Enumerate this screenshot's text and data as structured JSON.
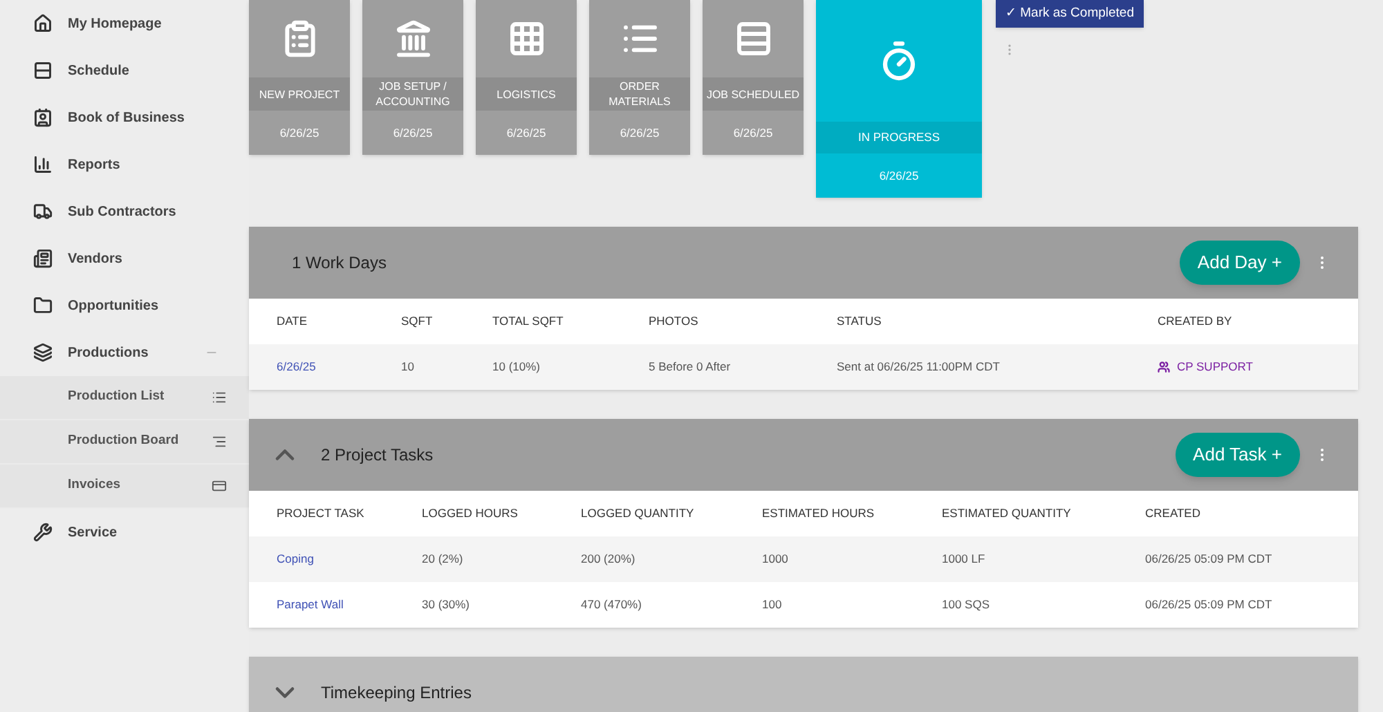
{
  "sidebar": {
    "items": [
      {
        "label": "My Homepage"
      },
      {
        "label": "Schedule"
      },
      {
        "label": "Book of Business"
      },
      {
        "label": "Reports"
      },
      {
        "label": "Sub Contractors"
      },
      {
        "label": "Vendors"
      },
      {
        "label": "Opportunities"
      },
      {
        "label": "Productions",
        "expanded": true,
        "children": [
          {
            "label": "Production List"
          },
          {
            "label": "Production Board"
          },
          {
            "label": "Invoices"
          }
        ]
      },
      {
        "label": "Service"
      }
    ]
  },
  "stages": [
    {
      "label": "NEW PROJECT",
      "date": "6/26/25",
      "current": false
    },
    {
      "label": "JOB SETUP / ACCOUNTING",
      "date": "6/26/25",
      "current": false
    },
    {
      "label": "LOGISTICS",
      "date": "6/26/25",
      "current": false
    },
    {
      "label": "ORDER MATERIALS",
      "date": "6/26/25",
      "current": false
    },
    {
      "label": "JOB SCHEDULED",
      "date": "6/26/25",
      "current": false
    },
    {
      "label": "IN PROGRESS",
      "date": "6/26/25",
      "current": true
    }
  ],
  "mark_button": "✓ Mark as Completed",
  "sections": [
    {
      "title": "1 Work Days",
      "button": "Add Day +",
      "columns": [
        {
          "label": "DATE",
          "kind": "link"
        },
        {
          "label": "SQFT",
          "kind": "text"
        },
        {
          "label": "TOTAL SQFT",
          "kind": "text"
        },
        {
          "label": "PHOTOS",
          "kind": "text"
        },
        {
          "label": "STATUS",
          "kind": "text"
        },
        {
          "label": "CREATED BY",
          "kind": "user"
        }
      ],
      "rows": [
        [
          "6/26/25",
          "10",
          "10 (10%)",
          "5 Before 0 After",
          "Sent at 06/26/25 11:00PM CDT",
          "CP SUPPORT"
        ]
      ]
    },
    {
      "title": "2 Project Tasks",
      "expanded": true,
      "button": "Add Task +",
      "columns": [
        {
          "label": "PROJECT TASK",
          "kind": "link"
        },
        {
          "label": "LOGGED HOURS",
          "kind": "text"
        },
        {
          "label": "LOGGED QUANTITY",
          "kind": "text"
        },
        {
          "label": "ESTIMATED HOURS",
          "kind": "text"
        },
        {
          "label": "ESTIMATED QUANTITY",
          "kind": "text"
        },
        {
          "label": "CREATED",
          "kind": "text"
        }
      ],
      "rows": [
        [
          "Coping",
          "20 (2%)",
          "200 (20%)",
          "1000",
          "1000 LF",
          "06/26/25 05:09 PM CDT"
        ],
        [
          "Parapet Wall",
          "30 (30%)",
          "470 (470%)",
          "100",
          "100 SQS",
          "06/26/25 05:09 PM CDT"
        ]
      ]
    },
    {
      "title": "Timekeeping Entries",
      "expanded": false
    }
  ]
}
